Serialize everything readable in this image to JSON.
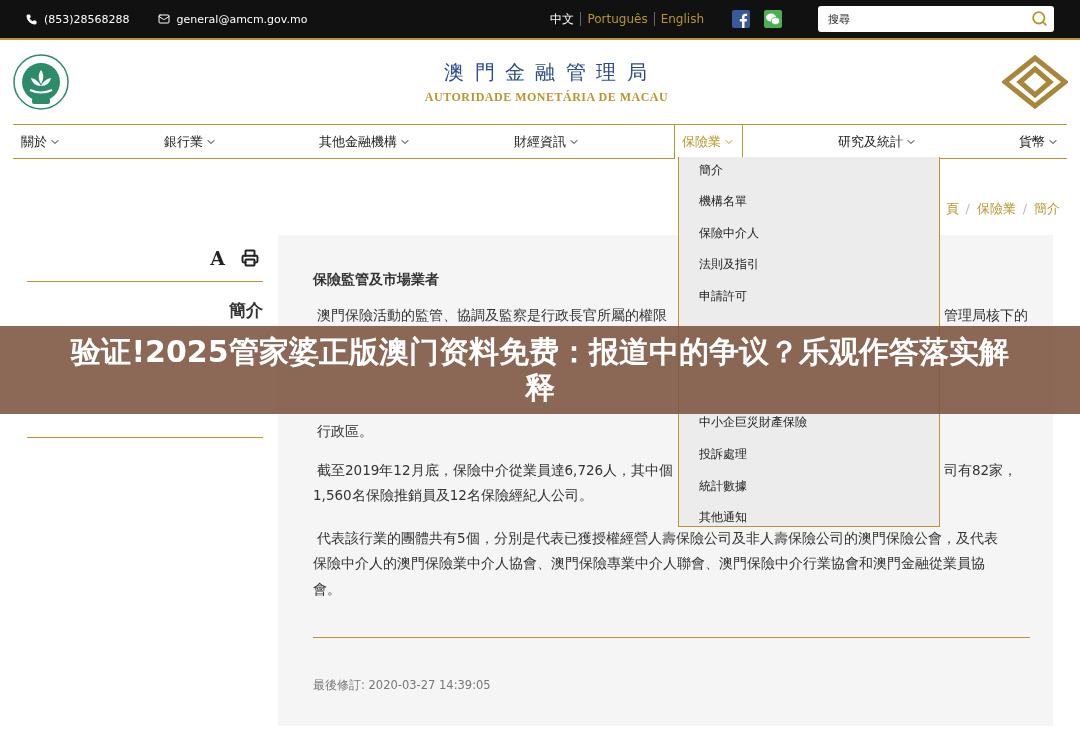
{
  "top_bar": {
    "phone": "(853)28568288",
    "email": "general@amcm.gov.mo",
    "languages": [
      {
        "label": "中文",
        "selected": true
      },
      {
        "label": "Português",
        "selected": false
      },
      {
        "label": "English",
        "selected": false
      }
    ],
    "search": {
      "placeholder": "搜尋"
    }
  },
  "header": {
    "title": "澳 門 金 融 管 理 局",
    "subtitle": "AUTORIDADE MONETÁRIA DE MACAU"
  },
  "nav": [
    {
      "label": "關於",
      "selected": false
    },
    {
      "label": "銀行業",
      "selected": false
    },
    {
      "label": "其他金融機構",
      "selected": false
    },
    {
      "label": "財經資訊",
      "selected": false
    },
    {
      "label": "保險業",
      "selected": true
    },
    {
      "label": "研究及統計",
      "selected": false
    },
    {
      "label": "貨幣",
      "selected": false
    }
  ],
  "dropdown": {
    "items": [
      "簡介",
      "機構名單",
      "保險中介人",
      "法則及指引",
      "申請許可",
      "中小企巨災財產保險",
      "投訴處理",
      "統計數據",
      "其他通知"
    ]
  },
  "breadcrumb": {
    "items": [
      "頁",
      "保險業",
      "簡介"
    ],
    "separator": "/"
  },
  "sidebar": {
    "font_size_control": "A",
    "title": "簡介"
  },
  "article": {
    "title": "保險監管及市場業者",
    "paragraphs": [
      {
        "lines": [
          {
            "segments": [
              "澳門保險活動的監管、協調及監察是行政長官所屬的權限",
              "管理局核下的"
            ]
          }
        ]
      },
      {
        "lines": [
          {
            "segments": [
              "行政區。"
            ]
          }
        ]
      },
      {
        "lines": [
          {
            "segments": [
              "截至2019年12月底，保險中介從業員達6,726人，其中個",
              "司有82家，"
            ]
          },
          {
            "segments": [
              "1,560名保險推銷員及12名保險經紀人公司。"
            ]
          }
        ]
      },
      {
        "lines": [
          {
            "segments": [
              "代表該行業的團體共有5個，分別是代表已獲授權經營人壽保險公司及非人壽保險公司的澳門保險公會，及代表"
            ]
          },
          {
            "segments": [
              "保險中介人的澳門保險業中介人協會、澳門保險專業中介人聯會、澳門保險中介行業協會和澳門金融從業員協"
            ]
          },
          {
            "segments": [
              "會。"
            ]
          }
        ]
      }
    ],
    "last_modified": "最後修訂: 2020-03-27 14:39:05"
  },
  "overlay_banner": {
    "text": "验证!2025管家婆正版澳门资料免费：报道中的争议？乐观作答落实解释"
  }
}
